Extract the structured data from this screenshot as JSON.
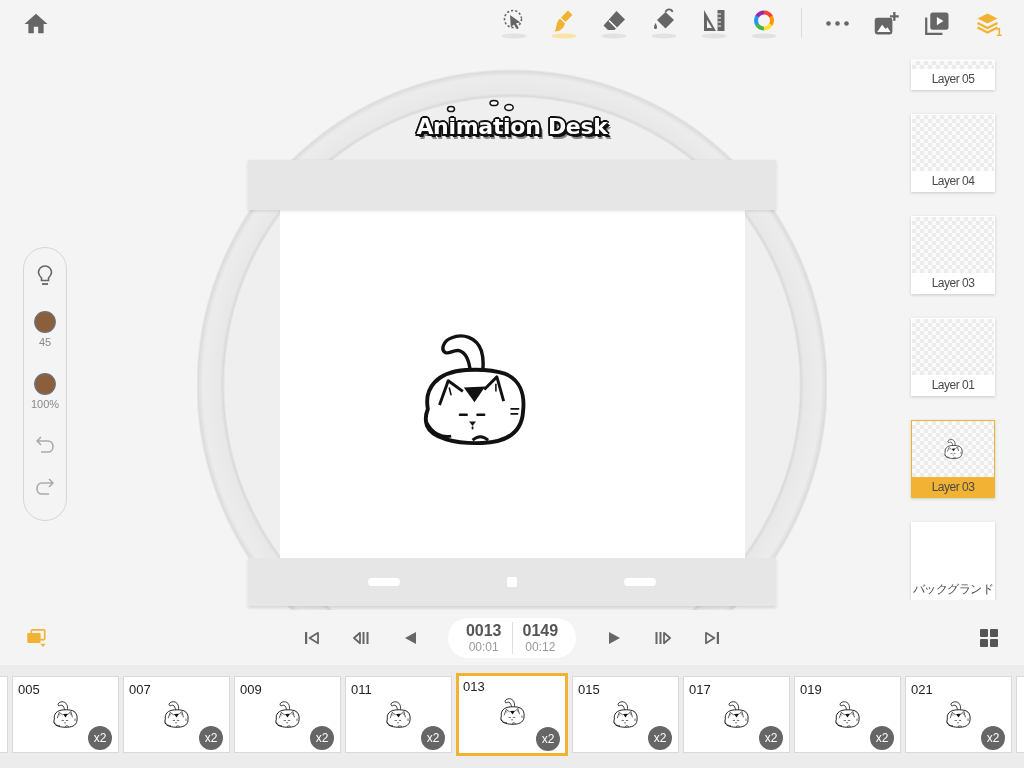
{
  "toolbar": {
    "tools": [
      {
        "kind": "lasso",
        "selected": false
      },
      {
        "kind": "brush",
        "selected": true
      },
      {
        "kind": "eraser",
        "selected": false
      },
      {
        "kind": "fill",
        "selected": false
      },
      {
        "kind": "ruler",
        "selected": false
      },
      {
        "kind": "color",
        "selected": false
      }
    ],
    "actions": [
      {
        "kind": "more",
        "active": false
      },
      {
        "kind": "add_image",
        "active": false
      },
      {
        "kind": "preview",
        "active": false
      },
      {
        "kind": "layers",
        "active": true,
        "count": "1"
      }
    ]
  },
  "logo": "Animation Desk",
  "brush_panel": {
    "color": "#8b5e3c",
    "size": "45",
    "opacity": "100%"
  },
  "layers": [
    {
      "name": "Layer 05",
      "kind": "empty",
      "selected": false
    },
    {
      "name": "Layer 04",
      "kind": "empty",
      "selected": false
    },
    {
      "name": "Layer 03",
      "kind": "empty",
      "selected": false
    },
    {
      "name": "Layer 01",
      "kind": "empty",
      "selected": false
    },
    {
      "name": "Layer 03",
      "kind": "drawing",
      "selected": true
    },
    {
      "name": "バックグランド",
      "kind": "background",
      "selected": false
    }
  ],
  "playback": {
    "current_frame": "0013",
    "current_time": "00:01",
    "total_frames": "0149",
    "total_time": "00:12"
  },
  "frames": [
    {
      "number": "005",
      "hold": "x2",
      "selected": false
    },
    {
      "number": "007",
      "hold": "x2",
      "selected": false
    },
    {
      "number": "009",
      "hold": "x2",
      "selected": false
    },
    {
      "number": "011",
      "hold": "x2",
      "selected": false
    },
    {
      "number": "013",
      "hold": "x2",
      "selected": true
    },
    {
      "number": "015",
      "hold": "x2",
      "selected": false
    },
    {
      "number": "017",
      "hold": "x2",
      "selected": false
    },
    {
      "number": "019",
      "hold": "x2",
      "selected": false
    },
    {
      "number": "021",
      "hold": "x2",
      "selected": false
    }
  ]
}
